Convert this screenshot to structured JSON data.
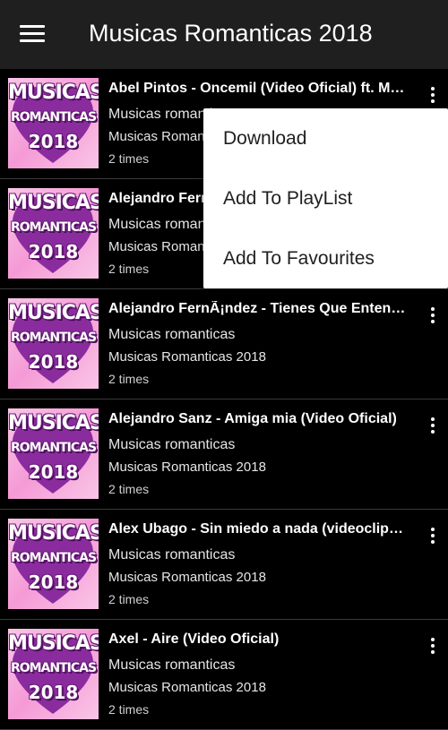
{
  "appbar": {
    "title": "Musicas Romanticas 2018",
    "menu_icon": "hamburger-menu-icon",
    "background": "#1f1f1f"
  },
  "thumbnail": {
    "line1": "MUSICAS",
    "line2": "ROMANTICAS",
    "line3": "2018",
    "heart_color": "#8b2c9e"
  },
  "songs": [
    {
      "title": "Abel Pintos - Oncemil (Video Oficial) ft. Ma...",
      "artist": "Musicas romanticas",
      "album": "Musicas Romanticas 2018",
      "plays": "2 times"
    },
    {
      "title": "Alejandro Fernández - ...",
      "artist": "Musicas romanticas",
      "album": "Musicas Romanticas 2018",
      "plays": "2 times"
    },
    {
      "title": "Alejandro FernÃ¡ndez - Tienes Que Entend...",
      "artist": "Musicas romanticas",
      "album": "Musicas Romanticas 2018",
      "plays": "2 times"
    },
    {
      "title": "Alejandro Sanz - Amiga mia (Video Oficial)",
      "artist": "Musicas romanticas",
      "album": "Musicas Romanticas 2018",
      "plays": "2 times"
    },
    {
      "title": "Alex Ubago - Sin miedo a nada (videoclip o...",
      "artist": "Musicas romanticas",
      "album": "Musicas Romanticas 2018",
      "plays": "2 times"
    },
    {
      "title": "Axel - Aire (Video Oficial)",
      "artist": "Musicas romanticas",
      "album": "Musicas Romanticas 2018",
      "plays": "2 times"
    }
  ],
  "popup_menu": {
    "items": [
      "Download",
      "Add To PlayList",
      "Add To Favourites"
    ]
  }
}
